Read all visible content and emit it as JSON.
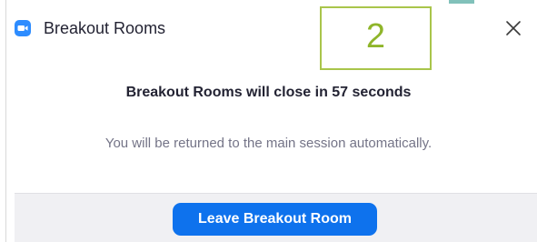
{
  "window": {
    "title": "Breakout Rooms",
    "app_icon": "zoom-camera-icon",
    "close_icon": "close-icon"
  },
  "annotation": {
    "number": "2",
    "color": "#a9c54b"
  },
  "dialog": {
    "heading": "Breakout Rooms will close in 57 seconds",
    "message": "You will be returned to the main session automatically."
  },
  "footer": {
    "leave_button_label": "Leave Breakout Room"
  },
  "colors": {
    "primary_button": "#0e72ed",
    "app_icon": "#2d8cff",
    "footer_bg": "#f0f0f3"
  }
}
